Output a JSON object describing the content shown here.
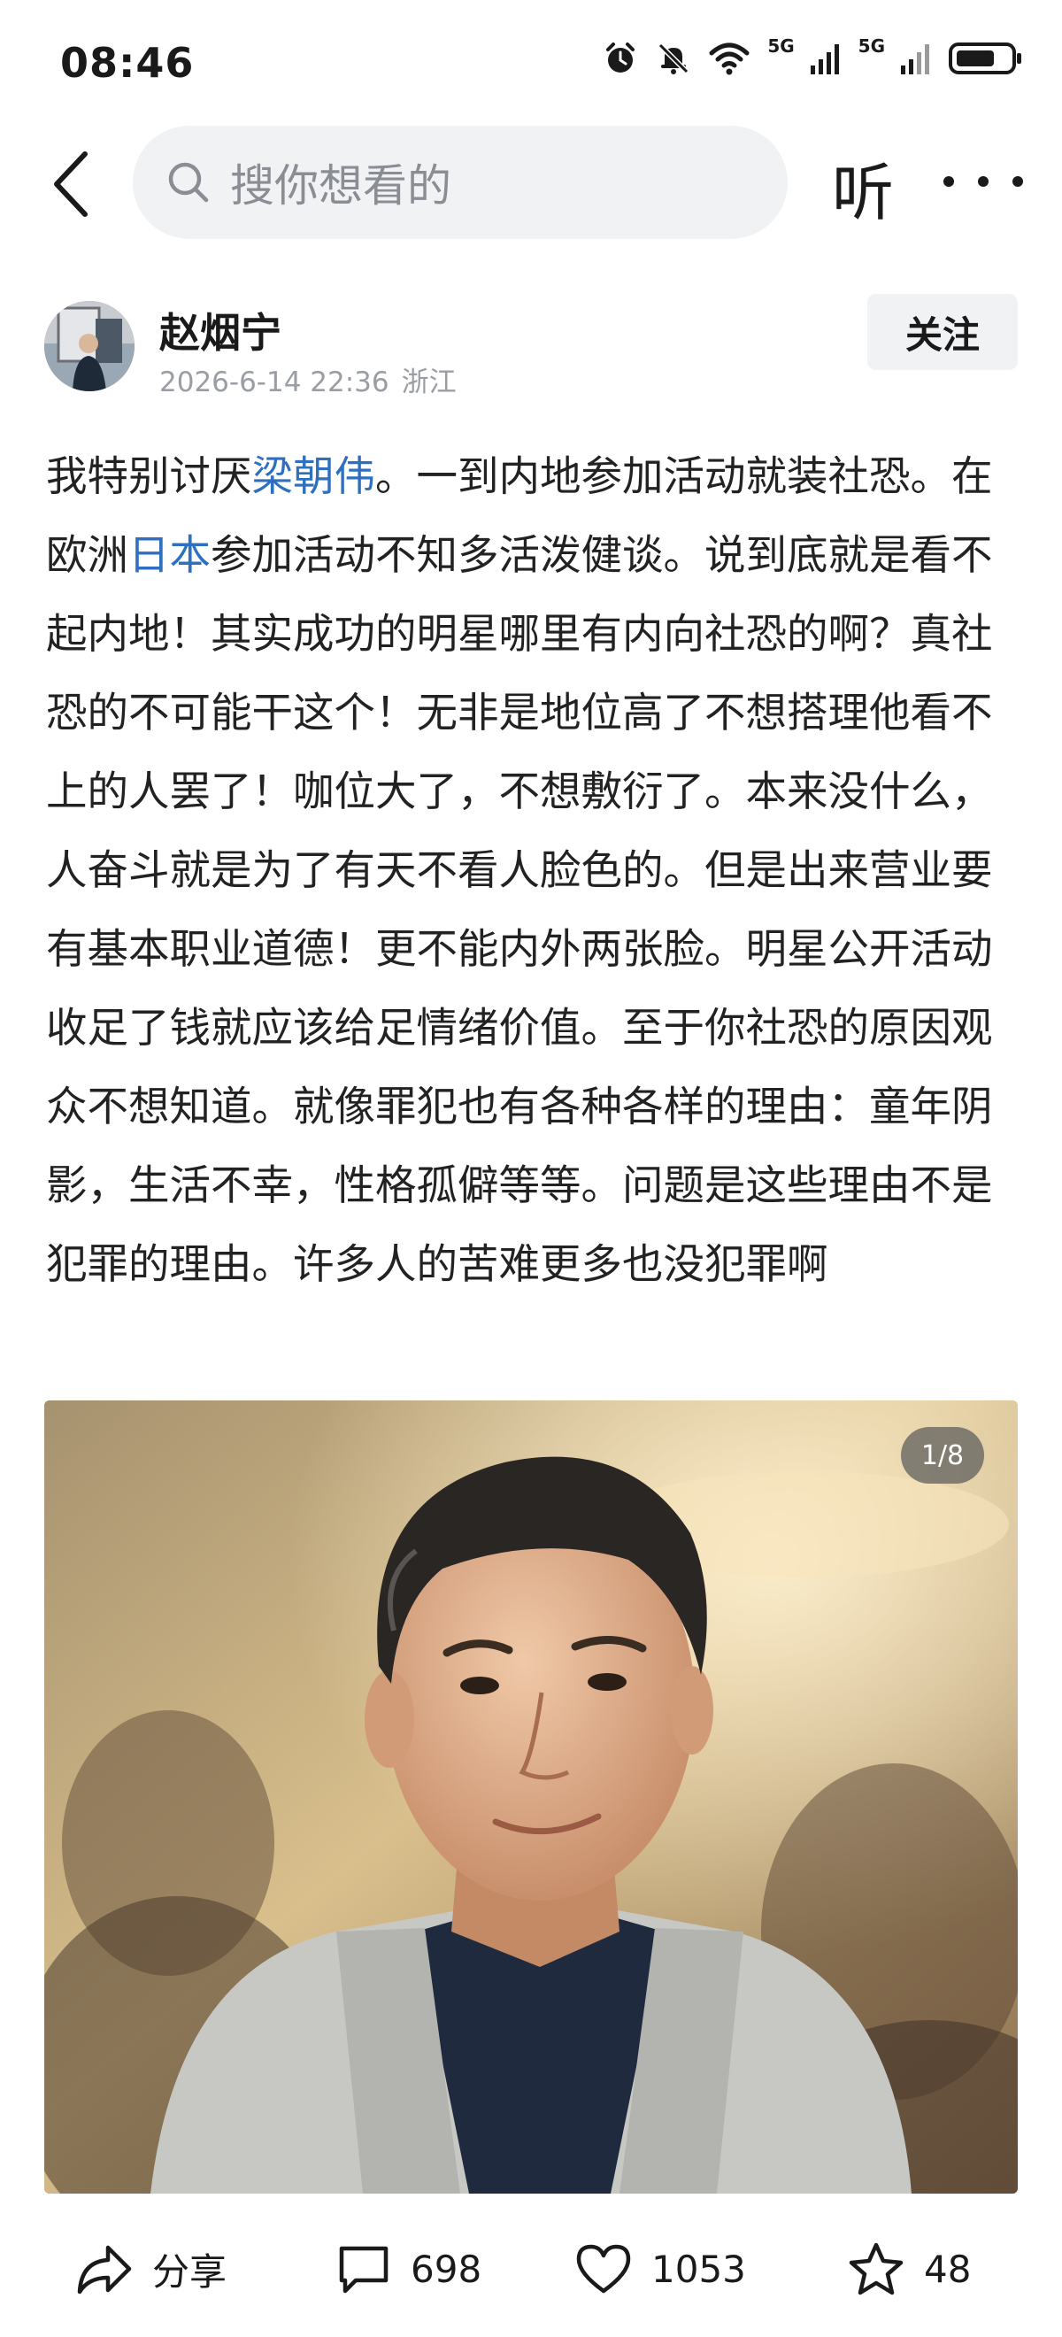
{
  "status_bar": {
    "time": "08:46",
    "network_1": "5G",
    "network_2": "5G",
    "icons": [
      "alarm-icon",
      "mute-icon",
      "wifi-icon",
      "signal-icon",
      "signal-icon",
      "battery-icon"
    ]
  },
  "header": {
    "search_placeholder": "搜你想看的",
    "listen_label": "听"
  },
  "author": {
    "name": "赵烟宁",
    "date": "2026-6-14 22:36",
    "location": "浙江",
    "follow_label": "关注"
  },
  "post": {
    "text_1": "我特别讨厌",
    "link_1": "梁朝伟",
    "text_2": "。一到内地参加活动就装社恐。在欧洲",
    "link_2": "日本",
    "text_3": "参加活动不知多活泼健谈。说到底就是看不起内地！其实成功的明星哪里有内向社恐的啊？真社恐的不可能干这个！无非是地位高了不想搭理他看不上的人罢了！咖位大了，不想敷衍了。本来没什么，人奋斗就是为了有天不看人脸色的。但是出来营业要有基本职业道德！更不能内外两张脸。明星公开活动收足了钱就应该给足情绪价值。至于你社恐的原因观众不想知道。就像罪犯也有各种各样的理由：童年阴影，生活不幸，性格孤僻等等。问题是这些理由不是犯罪的理由。许多人的苦难更多也没犯罪啊",
    "image_counter": "1/8"
  },
  "actions": {
    "share_label": "分享",
    "comment_count": "698",
    "like_count": "1053",
    "favorite_count": "48"
  },
  "colors": {
    "link": "#2f6fbf",
    "search_bg": "#f1f2f4",
    "meta_text": "#9a9da3"
  }
}
